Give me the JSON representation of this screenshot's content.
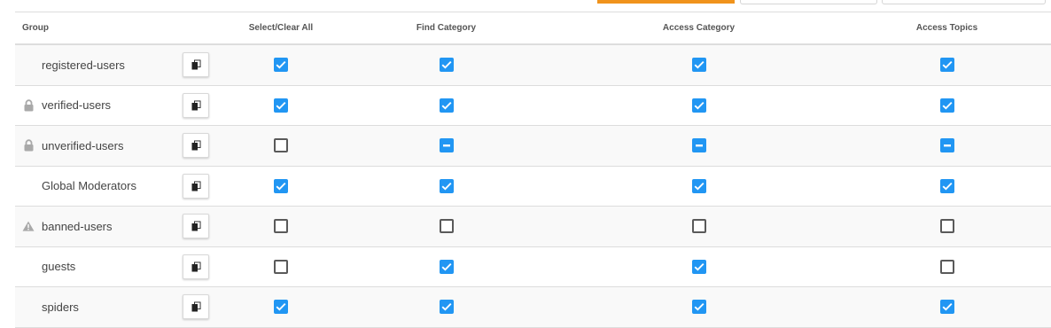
{
  "header": {
    "group": "Group",
    "select_clear_all": "Select/Clear All",
    "find_category": "Find Category",
    "access_category": "Access Category",
    "access_topics": "Access Topics"
  },
  "rows": [
    {
      "name": "registered-users",
      "icon": "none",
      "select": "checked",
      "find": "checked",
      "access": "checked",
      "topics": "checked"
    },
    {
      "name": "verified-users",
      "icon": "lock-icon",
      "select": "checked",
      "find": "checked",
      "access": "checked",
      "topics": "checked"
    },
    {
      "name": "unverified-users",
      "icon": "lock-icon",
      "select": "unchecked",
      "find": "partial",
      "access": "partial",
      "topics": "partial"
    },
    {
      "name": "Global Moderators",
      "icon": "none",
      "select": "checked",
      "find": "checked",
      "access": "checked",
      "topics": "checked"
    },
    {
      "name": "banned-users",
      "icon": "warning-icon",
      "select": "unchecked",
      "find": "unchecked",
      "access": "unchecked",
      "topics": "unchecked"
    },
    {
      "name": "guests",
      "icon": "none",
      "select": "unchecked",
      "find": "checked",
      "access": "checked",
      "topics": "unchecked"
    },
    {
      "name": "spiders",
      "icon": "none",
      "select": "checked",
      "find": "checked",
      "access": "checked",
      "topics": "checked"
    }
  ],
  "colors": {
    "accent": "#2196f3",
    "primary_button": "#f0931c",
    "icon_gray": "#a9a9a9"
  }
}
